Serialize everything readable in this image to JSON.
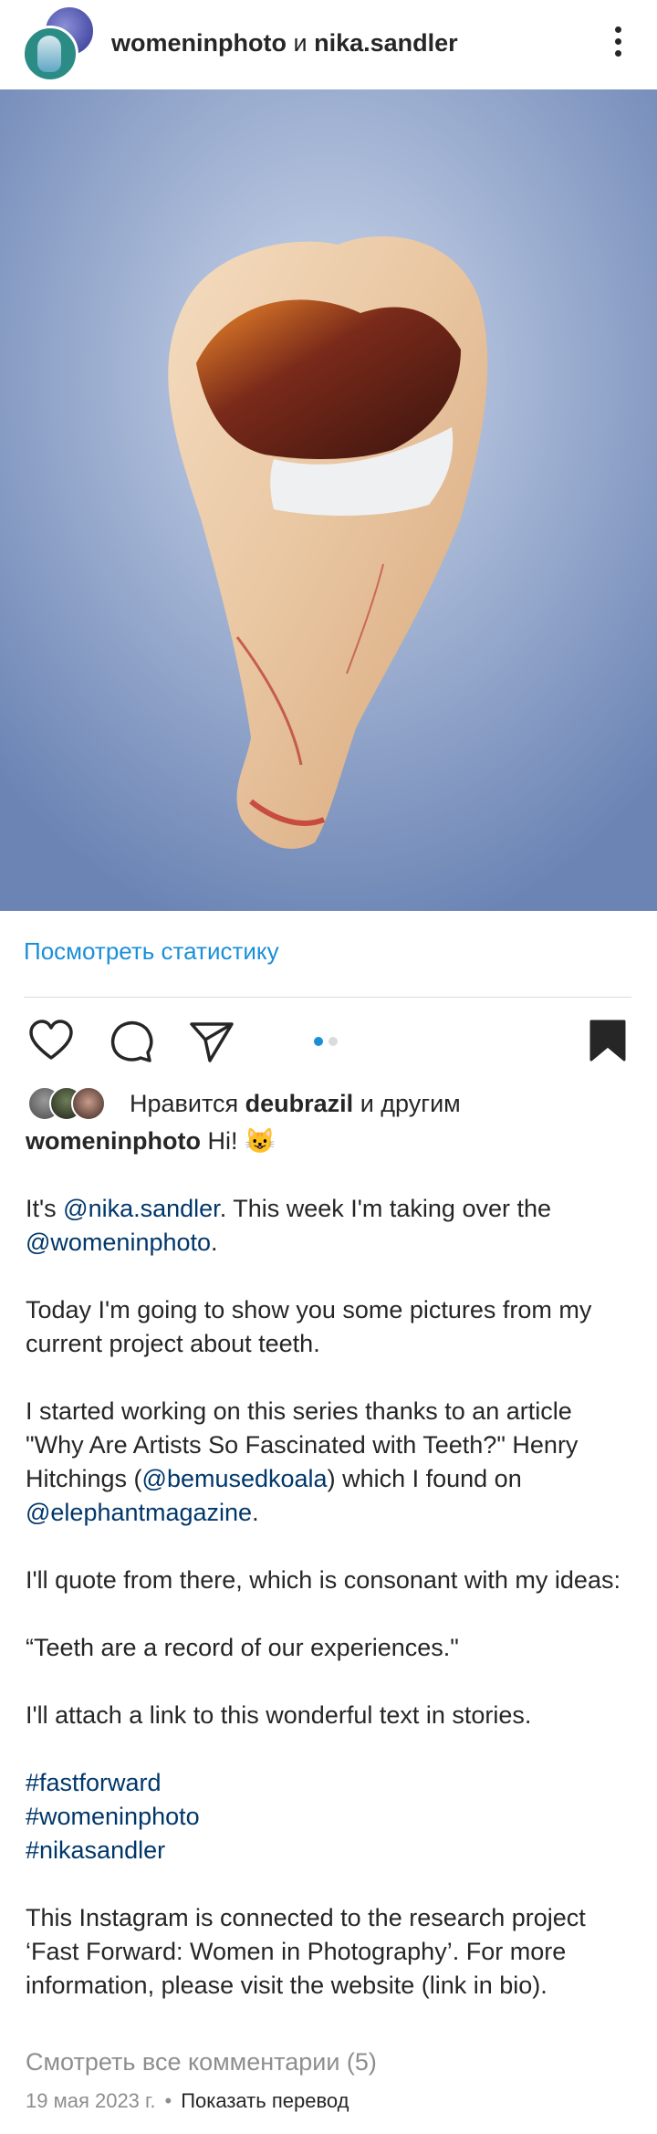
{
  "header": {
    "user1": "womeninphoto",
    "conj": "и",
    "user2": "nika.sandler",
    "more_icon": "more-vertical-icon"
  },
  "post": {
    "image_alt": "extracted tooth on blue background"
  },
  "stats_link": "Посмотреть статистику",
  "actions": {
    "icons": [
      "heart-icon",
      "comment-icon",
      "share-icon",
      "bookmark-icon"
    ],
    "carousel_pages": 2,
    "carousel_active": 1
  },
  "likes": {
    "prefix": "Нравится",
    "user": "deubrazil",
    "suffix": "и другим"
  },
  "caption": {
    "author": "womeninphoto",
    "intro": "Hi! 😺",
    "p1_a": "It's ",
    "p1_m1": "@nika.sandler",
    "p1_b": ". This week I'm taking over the ",
    "p1_m2": "@womeninphoto",
    "p1_c": ".",
    "p2": "Today I'm going to show you some pictures from my current project about teeth.",
    "p3_a": "I started working on this series thanks to an article \"Why Are Artists So Fascinated with Teeth?\" Henry Hitchings (",
    "p3_m1": "@bemusedkoala",
    "p3_b": ") which I found on ",
    "p3_m2": "@elephantmagazine",
    "p3_c": ".",
    "p4": "I'll quote from there, which is consonant with my ideas:",
    "p5": "“Teeth are a record of our experiences.\"",
    "p6": "I'll attach a link to this wonderful text in stories.",
    "tag1": "#fastforward",
    "tag2": "#womeninphoto",
    "tag3": "#nikasandler",
    "p7": "This Instagram is connected to the research project ‘Fast Forward: Women in Photography’. For more information, please visit the website (link in bio)."
  },
  "comments_link": "Смотреть все комментарии (5)",
  "meta": {
    "date": "19 мая 2023 г.",
    "sep": "•",
    "translate": "Показать перевод"
  },
  "colors": {
    "link": "#1a8fd8",
    "mention": "#00376b",
    "muted": "#8e8e8e",
    "text": "#262626"
  }
}
